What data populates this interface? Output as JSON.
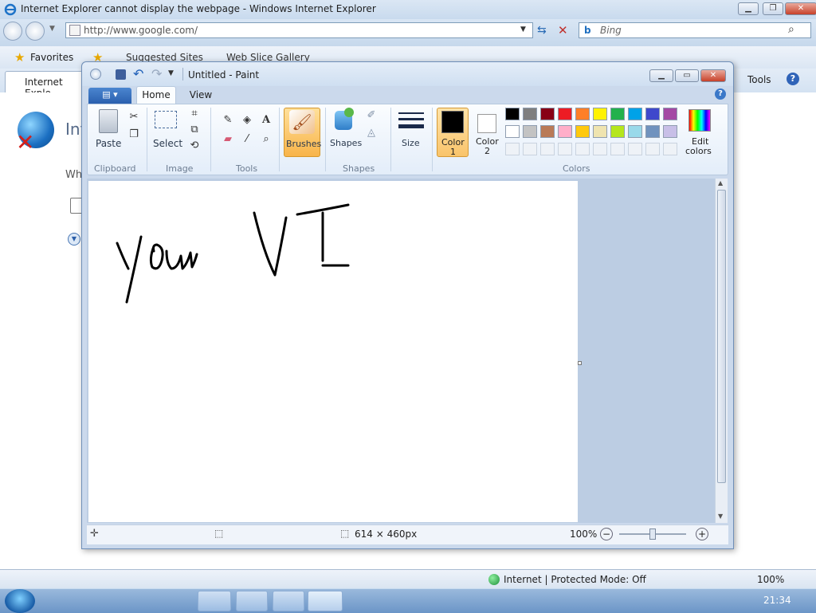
{
  "ie": {
    "title": "Internet Explorer cannot display the webpage - Windows Internet Explorer",
    "address": "http://www.google.com/",
    "search_placeholder": "Bing",
    "favorites_label": "Favorites",
    "suggested_sites": "Suggested Sites",
    "web_slice_gallery": "Web Slice Gallery",
    "tab_label": "Internet Explo",
    "tools_label": "Tools",
    "content_heading": "Int",
    "content_line": "Wh",
    "status_zone": "Internet | Protected Mode: Off",
    "zoom": "100%"
  },
  "paint": {
    "title": "Untitled - Paint",
    "tabs": [
      "Home",
      "View"
    ],
    "groups": {
      "clipboard": "Clipboard",
      "image": "Image",
      "tools": "Tools",
      "shapes": "Shapes",
      "colors": "Colors"
    },
    "buttons": {
      "paste": "Paste",
      "select": "Select",
      "brushes": "Brushes",
      "shapes": "Shapes",
      "size": "Size",
      "color1_line1": "Color",
      "color1_line2": "1",
      "color2_line1": "Color",
      "color2_line2": "2",
      "edit_colors_line1": "Edit",
      "edit_colors_line2": "colors"
    },
    "palette_row1": [
      "#000000",
      "#7f7f7f",
      "#880015",
      "#ed1c24",
      "#ff7f27",
      "#fff200",
      "#22b14c",
      "#00a2e8",
      "#3f48cc",
      "#a349a4"
    ],
    "palette_row2": [
      "#ffffff",
      "#c3c3c3",
      "#b97a57",
      "#ffaec9",
      "#ffc90e",
      "#efe4b0",
      "#b5e61d",
      "#99d9ea",
      "#7092be",
      "#c8bfe7"
    ],
    "color1": "#000000",
    "color2": "#ffffff",
    "canvas_size": "614 × 460px",
    "zoom": "100%",
    "drawn_text": "you VI"
  },
  "taskbar": {
    "clock": "21:34"
  }
}
